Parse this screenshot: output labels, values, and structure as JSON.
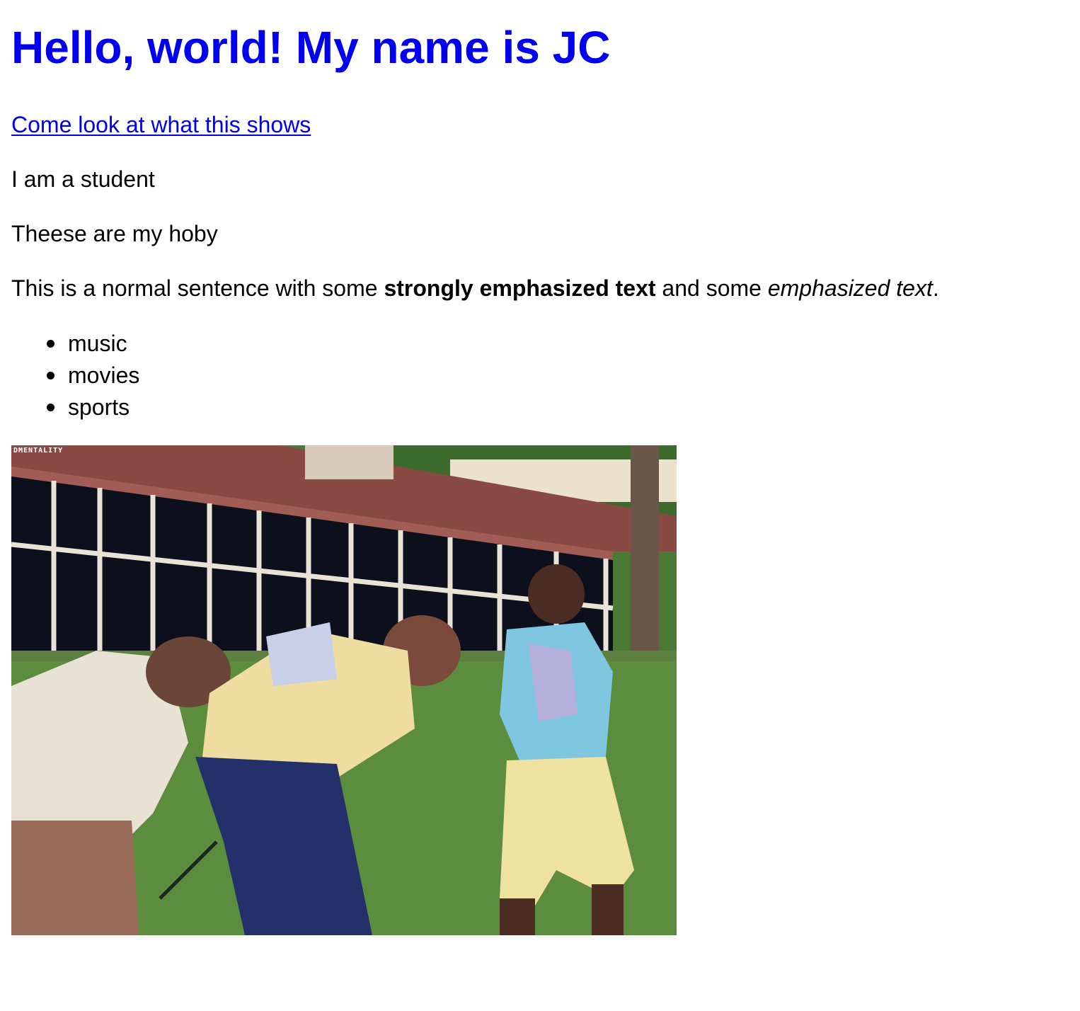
{
  "heading": "Hello, world! My name is JC",
  "link": {
    "text": "Come look at what this shows"
  },
  "paragraphs": {
    "student": "I am a student",
    "hobby_intro": "Theese are my hoby",
    "sentence": {
      "before": "This is a normal sentence with some ",
      "strong": "strongly emphasized text",
      "middle": " and some ",
      "em": "emphasized text",
      "after": "."
    }
  },
  "hobbies": [
    "music",
    "movies",
    "sports"
  ],
  "gif": {
    "watermark": "DMENTALITY",
    "subject": "three men dancing on a golf course"
  },
  "colors": {
    "heading": "#0000ee",
    "link": "#0000ee",
    "text": "#000000",
    "background": "#ffffff"
  }
}
